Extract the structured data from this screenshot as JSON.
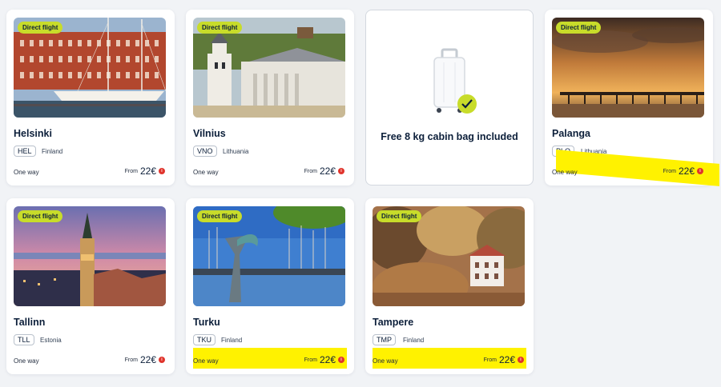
{
  "cards": [
    {
      "city": "Helsinki",
      "code": "HEL",
      "country": "Finland",
      "badge": "Direct flight",
      "trip": "One way",
      "from": "From",
      "price": "22€"
    },
    {
      "city": "Vilnius",
      "code": "VNO",
      "country": "Lithuania",
      "badge": "Direct flight",
      "trip": "One way",
      "from": "From",
      "price": "22€"
    },
    {
      "city": "Palanga",
      "code": "PLQ",
      "country": "Lithuania",
      "badge": "Direct flight",
      "trip": "One way",
      "from": "From",
      "price": "22€"
    },
    {
      "city": "Tallinn",
      "code": "TLL",
      "country": "Estonia",
      "badge": "Direct flight",
      "trip": "One way",
      "from": "From",
      "price": "22€"
    },
    {
      "city": "Turku",
      "code": "TKU",
      "country": "Finland",
      "badge": "Direct flight",
      "trip": "One way",
      "from": "From",
      "price": "22€"
    },
    {
      "city": "Tampere",
      "code": "TMP",
      "country": "Finland",
      "badge": "Direct flight",
      "trip": "One way",
      "from": "From",
      "price": "22€"
    }
  ],
  "promo": {
    "text": "Free 8 kg cabin bag included",
    "icon": "suitcase-check-icon"
  },
  "colors": {
    "badge": "#c8dc2a",
    "highlight": "#fff200",
    "info": "#e0342c",
    "text": "#0c1f3a"
  }
}
